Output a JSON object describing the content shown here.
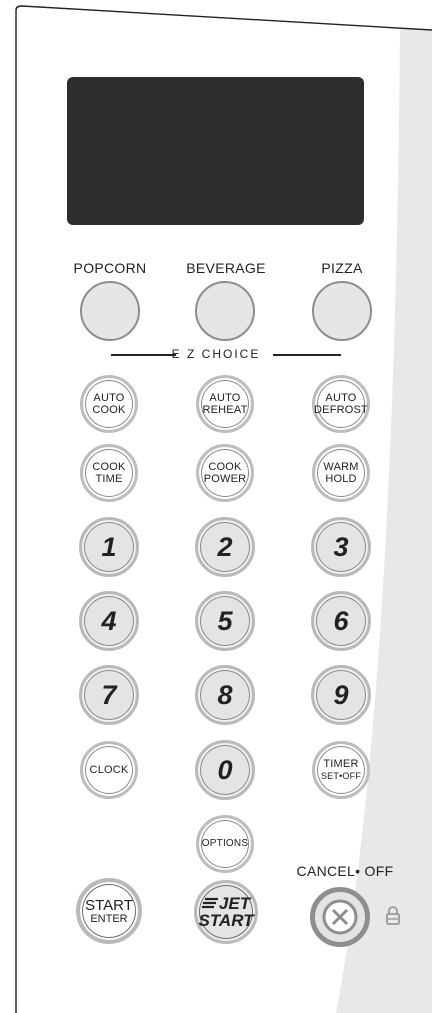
{
  "top_row": {
    "popcorn_label": "POPCORN",
    "beverage_label": "BEVERAGE",
    "pizza_label": "PIZZA"
  },
  "ez_choice": "E Z CHOICE",
  "buttons": {
    "auto_cook": [
      "AUTO",
      "COOK"
    ],
    "auto_reheat": [
      "AUTO",
      "REHEAT"
    ],
    "auto_defrost": [
      "AUTO",
      "DEFROST"
    ],
    "cook_time": [
      "COOK",
      "TIME"
    ],
    "cook_power": [
      "COOK",
      "POWER"
    ],
    "warm_hold": [
      "WARM",
      "HOLD"
    ],
    "clock": "CLOCK",
    "timer": [
      "TIMER",
      "SET•OFF"
    ],
    "options": "OPTIONS",
    "start": [
      "START",
      "ENTER"
    ],
    "jet_start": [
      "JET",
      "START"
    ],
    "cancel_label": "CANCEL• OFF"
  },
  "digits": [
    "1",
    "2",
    "3",
    "4",
    "5",
    "6",
    "7",
    "8",
    "9",
    "0"
  ],
  "icons": {
    "cancel": "close-circle-icon",
    "lock": "lock-icon",
    "jet": "jet-lines-icon"
  },
  "colors": {
    "display": "#2d2d2d",
    "button_fill": "#e4e4e6",
    "side_panel": "#e8e8ea"
  }
}
